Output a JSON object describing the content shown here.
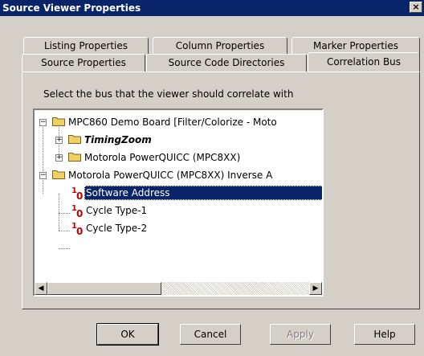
{
  "window": {
    "title": "Source Viewer Properties",
    "close_label": "×"
  },
  "tabs": {
    "row_back": [
      {
        "label": "Listing Properties"
      },
      {
        "label": "Column Properties"
      },
      {
        "label": "Marker Properties"
      }
    ],
    "row_front": [
      {
        "label": "Source Properties"
      },
      {
        "label": "Source Code Directories"
      },
      {
        "label": "Correlation Bus",
        "selected": true
      }
    ]
  },
  "panel": {
    "instruction": "Select the bus that the viewer should correlate with",
    "tree": {
      "nodes": [
        {
          "label": "MPC860 Demo Board [Filter/Colorize - Moto",
          "icon": "folder-icon",
          "expander": "−",
          "level": 0
        },
        {
          "label": "TimingZoom",
          "icon": "folder-icon",
          "expander": "+",
          "level": 1,
          "bold_italic": true
        },
        {
          "label": "Motorola PowerQUICC (MPC8XX)",
          "icon": "folder-icon",
          "expander": "+",
          "level": 1
        },
        {
          "label": "Motorola PowerQUICC (MPC8XX) Inverse A",
          "icon": "folder-icon",
          "expander": "−",
          "level": 0
        },
        {
          "label": "Software Address",
          "icon": "signal-icon",
          "level": 1,
          "selected": true
        },
        {
          "label": "Cycle Type-1",
          "icon": "signal-icon",
          "level": 1
        },
        {
          "label": "Cycle Type-2",
          "icon": "signal-icon",
          "level": 1
        }
      ],
      "signal_icon_text": {
        "one": "1",
        "zero": "0"
      },
      "scroll_left": "◀",
      "scroll_right": "▶"
    }
  },
  "buttons": {
    "ok": "OK",
    "cancel": "Cancel",
    "apply": "Apply",
    "help": "Help"
  },
  "colors": {
    "title_bar": "#0a246a",
    "face": "#d4d0c8",
    "selection": "#0a246a",
    "signal_icon": "#c00000",
    "folder": "#f0d060"
  }
}
